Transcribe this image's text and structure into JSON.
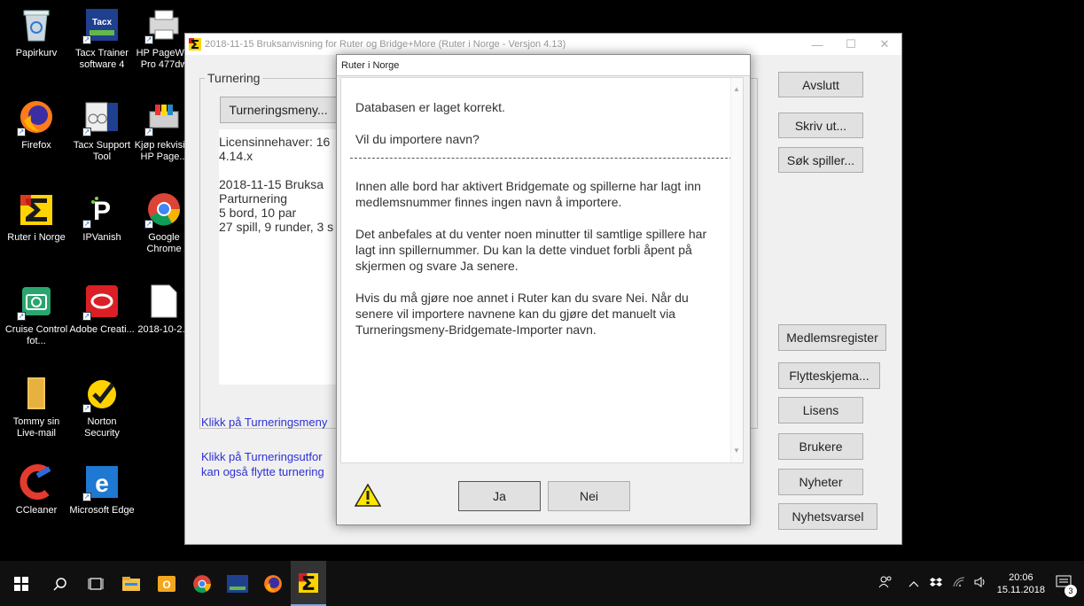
{
  "desktop": {
    "icons": [
      {
        "label": "Papirkurv"
      },
      {
        "label": "Tacx Trainer software 4"
      },
      {
        "label": "HP PageWid Pro 477dw"
      },
      {
        "label": "Firefox"
      },
      {
        "label": "Tacx Support Tool"
      },
      {
        "label": "Kjøp rekvisit - HP Page..."
      },
      {
        "label": "Ruter i Norge"
      },
      {
        "label": "IPVanish"
      },
      {
        "label": "Google Chrome"
      },
      {
        "label": "Cruise Control fot..."
      },
      {
        "label": "Adobe Creati..."
      },
      {
        "label": "2018-10-2..."
      },
      {
        "label": "Tommy sin Live-mail"
      },
      {
        "label": "Norton Security"
      },
      {
        "label": "CCleaner"
      },
      {
        "label": "Microsoft Edge"
      }
    ]
  },
  "main_window": {
    "title": "2018-11-15  Bruksanvisning for Ruter og Bridge+More  (Ruter i Norge - Versjon 4.13)",
    "group_label": "Turnering",
    "tournament_menu_button": "Turneringsmeny...",
    "info_lines": [
      "Licensinnehaver: 16",
      "4.14.x",
      "",
      "2018-11-15  Bruksa",
      "Parturnering",
      "5 bord, 10 par",
      "27 spill, 9 runder, 3 s"
    ],
    "links": [
      "Klikk på Turneringsmeny",
      "Klikk på Turneringsutfor",
      "kan også flytte turnering"
    ],
    "right_buttons_top": [
      "Avslutt",
      "Skriv ut...",
      "Søk spiller..."
    ],
    "right_buttons_bottom": [
      "Medlemsregister",
      "Flytteskjema...",
      "Lisens",
      "Brukere",
      "Nyheter",
      "Nyhetsvarsel"
    ]
  },
  "dialog": {
    "title": "Ruter i Norge",
    "line1": "Databasen er laget korrekt.",
    "line2": "Vil du importere navn?",
    "para1": "Innen alle bord har aktivert Bridgemate og spillerne har lagt inn medlemsnummer finnes ingen navn å importere.",
    "para2": "Det anbefales at du venter noen minutter til samtlige spillere har lagt inn spillernummer. Du kan la dette vinduet forbli åpent på skjermen og svare Ja senere.",
    "para3": "Hvis du må gjøre noe annet i Ruter kan du svare Nei. Når du senere vil importere navnene kan du gjøre det manuelt via Turneringsmeny-Bridgemate-Importer navn.",
    "yes_button": "Ja",
    "no_button": "Nei"
  },
  "taskbar": {
    "time": "20:06",
    "date": "15.11.2018",
    "notification_count": "3"
  }
}
